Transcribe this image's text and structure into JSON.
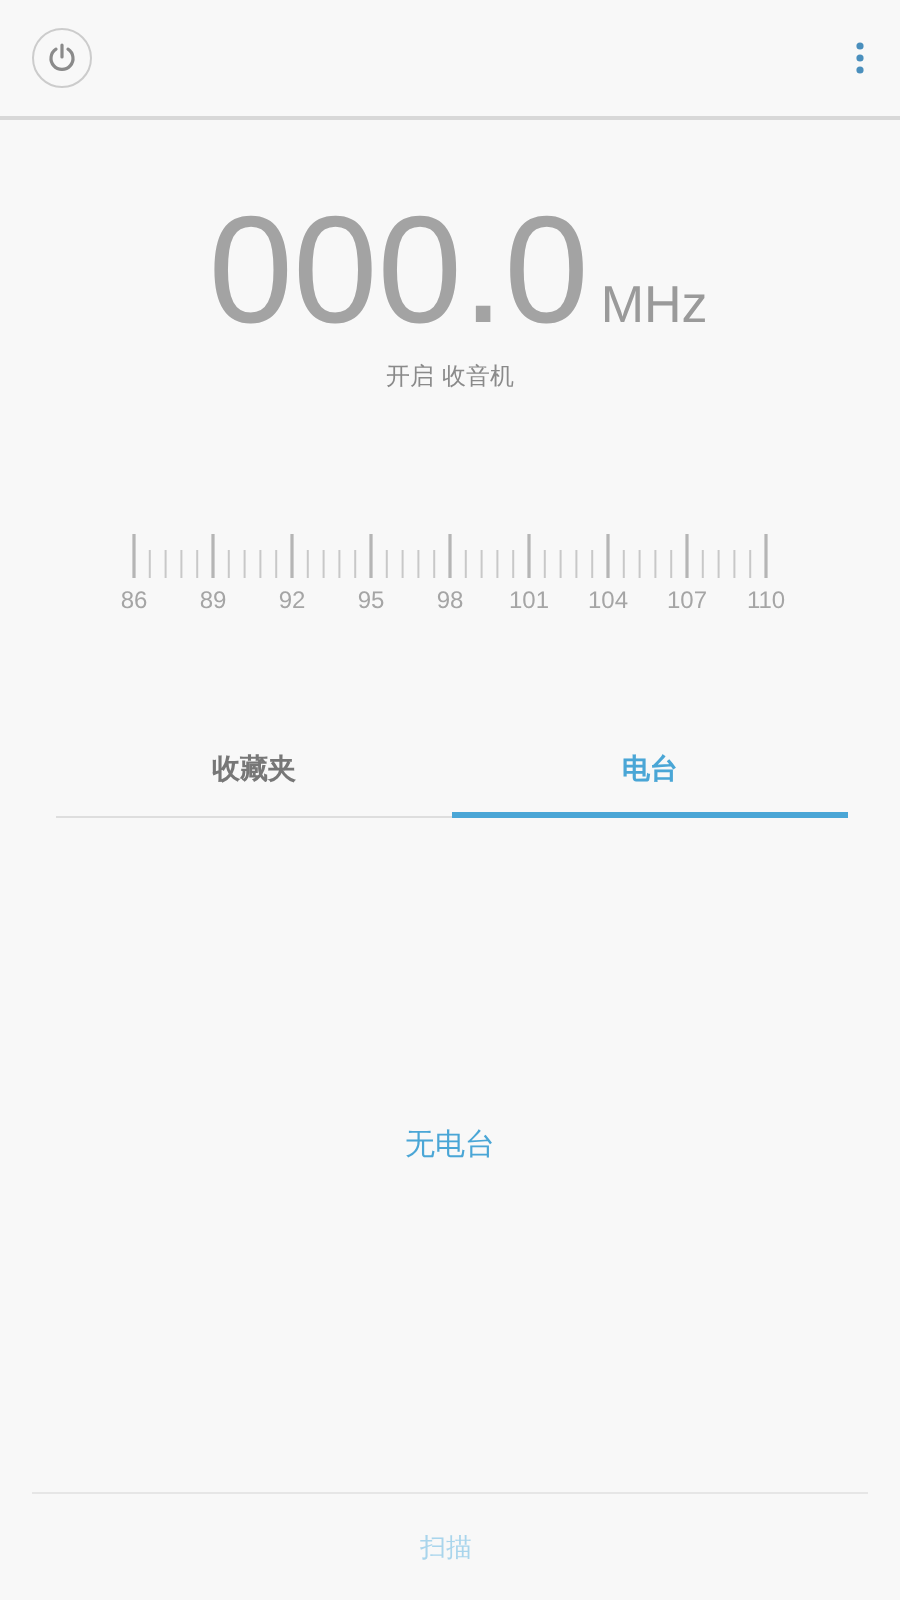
{
  "frequency": {
    "value": "000.0",
    "unit": "MHz",
    "status": "开启 收音机"
  },
  "scale": {
    "labels": [
      "86",
      "89",
      "92",
      "95",
      "98",
      "101",
      "104",
      "107",
      "110"
    ]
  },
  "tabs": [
    {
      "label": "收藏夹",
      "selected": false
    },
    {
      "label": "电台",
      "selected": true
    }
  ],
  "empty_message": "无电台",
  "scan_button": {
    "label": "扫描",
    "disabled": true
  }
}
